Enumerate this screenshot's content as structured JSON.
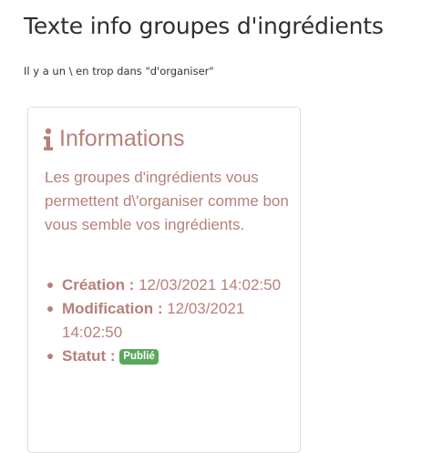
{
  "page": {
    "title": "Texte info groupes d'ingrédients",
    "description": "Il y a un \\ en trop dans \"d'organiser\""
  },
  "info_card": {
    "icon": "info-icon",
    "title": "Informations",
    "text": "Les groupes d'ingrédients vous permettent d\\'organiser comme bon vous semble vos ingrédients.",
    "accent_color": "#b7807a",
    "meta": {
      "creation_label": "Création :",
      "creation_value": "12/03/2021 14:02:50",
      "modification_label": "Modification :",
      "modification_value": "12/03/2021 14:02:50",
      "status_label": "Statut :",
      "status_value": "Publié",
      "status_color": "#5aa95a"
    }
  }
}
